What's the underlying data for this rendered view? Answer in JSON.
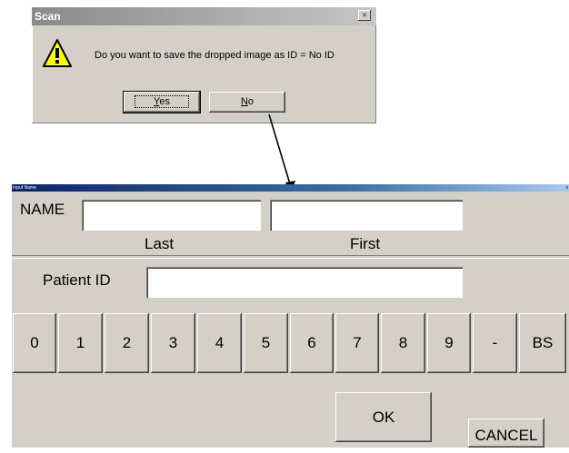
{
  "scan_dialog": {
    "title": "Scan",
    "close_glyph": "×",
    "message": "Do you want to save the dropped image as ID = No ID",
    "yes_button": {
      "accel": "Y",
      "rest": "es"
    },
    "no_button": {
      "accel": "N",
      "rest": "o"
    },
    "icon": "warning-icon"
  },
  "input_window": {
    "title": "Input Name",
    "close_glyph": "x",
    "name_label": "NAME",
    "last_label": "Last",
    "first_label": "First",
    "patient_id_label": "Patient ID",
    "last_value": "",
    "first_value": "",
    "patient_id_value": "",
    "keys": [
      "0",
      "1",
      "2",
      "3",
      "4",
      "5",
      "6",
      "7",
      "8",
      "9",
      "-",
      "BS"
    ],
    "ok_label": "OK",
    "cancel_label": "CANCEL"
  }
}
